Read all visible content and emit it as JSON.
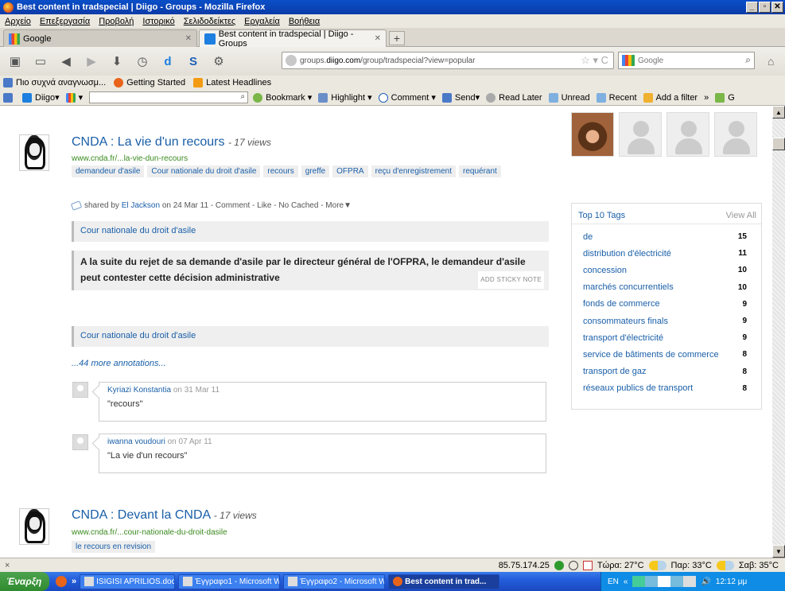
{
  "window": {
    "title": "Best content in tradspecial | Diigo - Groups - Mozilla Firefox"
  },
  "menu": [
    "Αρχείο",
    "Επεξεργασία",
    "Προβολή",
    "Ιστορικό",
    "Σελιδοδείκτες",
    "Εργαλεία",
    "Βοήθεια"
  ],
  "tabs": [
    {
      "label": "Google"
    },
    {
      "label": "Best content in tradspecial | Diigo - Groups"
    }
  ],
  "address": {
    "prefix": "groups.",
    "domain": "diigo.com",
    "path": "/group/tradspecial?view=popular"
  },
  "search": {
    "placeholder": "Google"
  },
  "bookmarks": [
    "Πιο συχνά αναγνωσμ...",
    "Getting Started",
    "Latest Headlines"
  ],
  "diigo_toolbar": {
    "logo": "Diigo",
    "items": [
      "Bookmark",
      "Highlight",
      "Comment",
      "Send",
      "Read Later",
      "Unread",
      "Recent",
      "Add a filter",
      "»",
      "G"
    ]
  },
  "bookmark1": {
    "title": "CNDA : La vie d'un recours",
    "views": "- 17 views",
    "url": "www.cnda.fr/...la-vie-dun-recours",
    "tags": [
      "demandeur d'asile",
      "Cour nationale du droit d'asile",
      "recours",
      "greffe",
      "OFPRA",
      "reçu d'enregistrement",
      "requérant"
    ],
    "shared_prefix": "shared by",
    "shared_user": "El Jackson",
    "shared_date": "on 24 Mar 11",
    "actions": "- Comment - Like - No Cached - More▼",
    "annotations": [
      "Cour nationale du droit d'asile",
      "A la suite du rejet de sa demande d'asile par le directeur général de l'OFPRA, le demandeur d'asile peut contester cette décision administrative",
      "Cour nationale du droit d'asile"
    ],
    "sticky": "ADD STICKY NOTE",
    "more_annotations": "...44 more annotations...",
    "comments": [
      {
        "user": "Kyriazi Konstantia",
        "date": "on 31 Mar 11",
        "text": "\"recours\""
      },
      {
        "user": "iwanna voudouri",
        "date": "on 07 Apr 11",
        "text": "\"La vie d'un recours\""
      }
    ]
  },
  "bookmark2": {
    "title": "CNDA : Devant la CNDA",
    "views": "- 17 views",
    "url": "www.cnda.fr/...cour-nationale-du-droit-dasile",
    "tags": [
      "le recours en revision"
    ]
  },
  "top_tags": {
    "title": "Top 10 Tags",
    "view_all": "View All",
    "rows": [
      {
        "tag": "de",
        "count": "15"
      },
      {
        "tag": "distribution d'électricité",
        "count": "11"
      },
      {
        "tag": "concession",
        "count": "10"
      },
      {
        "tag": "marchés concurrentiels",
        "count": "10"
      },
      {
        "tag": "fonds de commerce",
        "count": "9"
      },
      {
        "tag": "consommateurs finals",
        "count": "9"
      },
      {
        "tag": "transport d'électricité",
        "count": "9"
      },
      {
        "tag": "service de bâtiments de commerce",
        "count": "8"
      },
      {
        "tag": "transport de gaz",
        "count": "8"
      },
      {
        "tag": "réseaux publics de transport",
        "count": "8"
      }
    ]
  },
  "statusbar": {
    "close": "×",
    "ip": "85.75.174.25",
    "w_now": "Τώρα: 27°C",
    "w_sat": "Παρ: 33°C",
    "w_sun": "Σαβ: 35°C"
  },
  "taskbar": {
    "start": "Έναρξη",
    "chevron": "»",
    "tasks": [
      "ISIGISI APRILIOS.doc - ...",
      "Έγγραφο1 - Microsoft W...",
      "Έγγραφο2 - Microsoft W...",
      "Best content in trad..."
    ],
    "lang": "EN",
    "time": "12:12 μμ"
  }
}
